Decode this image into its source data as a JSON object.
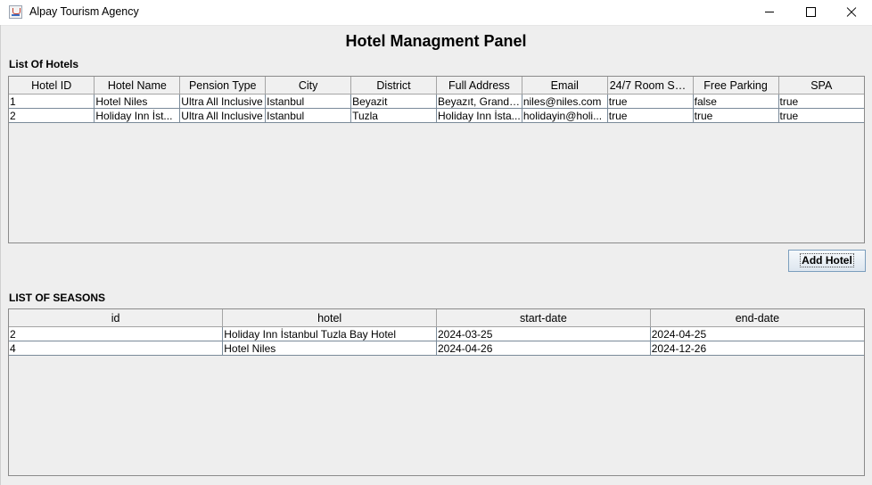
{
  "window": {
    "title": "Alpay Tourism Agency"
  },
  "panel": {
    "title": "Hotel Managment Panel"
  },
  "hotels": {
    "label": "List Of Hotels",
    "columns": [
      "Hotel ID",
      "Hotel Name",
      "Pension Type",
      "City",
      "District",
      "Full Address",
      "Email",
      "24/7 Room Ser...",
      "Free Parking",
      "SPA"
    ],
    "rows": [
      [
        "1",
        "Hotel Niles",
        "Ultra All Inclusive",
        "Istanbul",
        "Beyazit",
        "Beyazıt, Grand ...",
        "niles@niles.com",
        "true",
        "false",
        "true"
      ],
      [
        "2",
        "Holiday Inn İst...",
        "Ultra All Inclusive",
        "Istanbul",
        "Tuzla",
        "Holiday Inn İsta...",
        "holidayin@holi...",
        "true",
        "true",
        "true"
      ]
    ]
  },
  "add_button": {
    "label": "Add Hotel"
  },
  "seasons": {
    "label": "LIST OF SEASONS",
    "columns": [
      "id",
      "hotel",
      "start-date",
      "end-date"
    ],
    "rows": [
      [
        "2",
        " Holiday Inn İstanbul Tuzla Bay Hotel",
        "2024-03-25",
        "2024-04-25"
      ],
      [
        "4",
        "Hotel Niles",
        "2024-04-26",
        "2024-12-26"
      ]
    ]
  }
}
